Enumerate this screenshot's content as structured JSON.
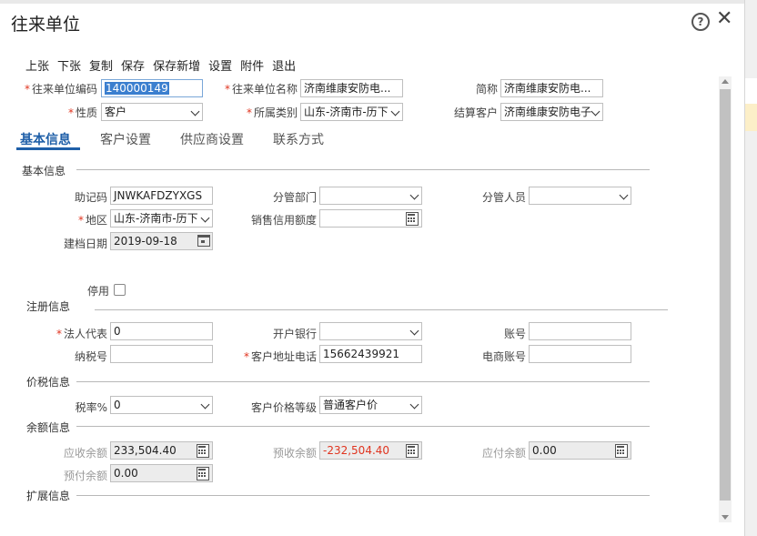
{
  "dialog": {
    "title": "往来单位"
  },
  "toolbar": [
    "上张",
    "下张",
    "复制",
    "保存",
    "保存新增",
    "设置",
    "附件",
    "退出"
  ],
  "header_fields": {
    "code_label": "往来单位编码",
    "code_value": "140000149",
    "name_label": "往来单位名称",
    "name_value": "济南维康安防电...",
    "short_label": "简称",
    "short_value": "济南维康安防电...",
    "nature_label": "性质",
    "nature_value": "客户",
    "category_label": "所属类别",
    "category_value": "山东-济南市-历下",
    "settle_label": "结算客户",
    "settle_value": "济南维康安防电子"
  },
  "tabs": [
    "基本信息",
    "客户设置",
    "供应商设置",
    "联系方式"
  ],
  "basic": {
    "section": "基本信息",
    "mnemonic_label": "助记码",
    "mnemonic_value": "JNWKAFDZYXGS",
    "dept_label": "分管部门",
    "dept_value": "",
    "staff_label": "分管人员",
    "staff_value": "",
    "region_label": "地区",
    "region_value": "山东-济南市-历下",
    "credit_label": "销售信用额度",
    "credit_value": "",
    "date_label": "建档日期",
    "date_value": "2019-09-18",
    "disabled_label": "停用"
  },
  "registration": {
    "section": "注册信息",
    "legal_label": "法人代表",
    "legal_value": "0",
    "bank_label": "开户银行",
    "bank_value": "",
    "account_label": "账号",
    "account_value": "",
    "taxno_label": "纳税号",
    "taxno_value": "",
    "addr_label": "客户地址电话",
    "addr_value": "15662439921",
    "ecom_label": "电商账号",
    "ecom_value": ""
  },
  "tax": {
    "section": "价税信息",
    "rate_label": "税率%",
    "rate_value": "0",
    "price_label": "客户价格等级",
    "price_value": "普通客户价"
  },
  "balance": {
    "section": "余额信息",
    "receivable_label": "应收余额",
    "receivable_value": "233,504.40",
    "prereceived_label": "预收余额",
    "prereceived_value": "-232,504.40",
    "payable_label": "应付余额",
    "payable_value": "0.00",
    "prepaid_label": "预付余额",
    "prepaid_value": "0.00"
  },
  "ext": {
    "section": "扩展信息"
  },
  "colors": {
    "accent": "#1f5fa8",
    "required": "#e0341f",
    "negative": "#e0341f"
  }
}
